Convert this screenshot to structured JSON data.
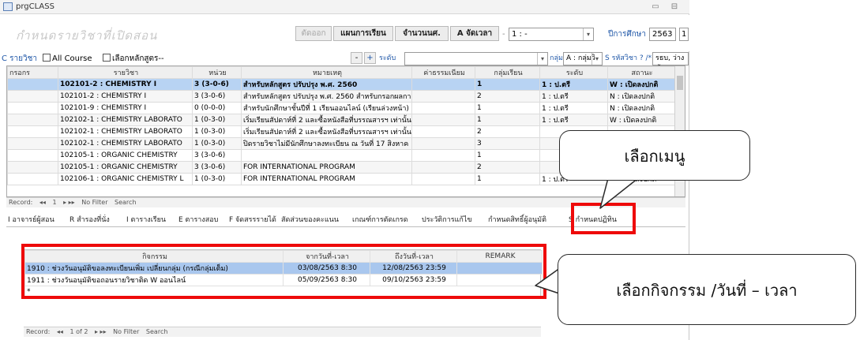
{
  "window": {
    "title": "prgCLASS"
  },
  "header": {
    "logo_text": "กำหนดรายวิชาที่เปิดสอน",
    "delete_label": "ตัดออก",
    "plan_label": "แผนการเรียน",
    "count_label": "จำนวนนศ.",
    "schedule_label": "A จัดเวลา",
    "semester_value": "1 : -",
    "year_label": "ปีการศึกษา",
    "year_value": "2563",
    "year_suffix": "1"
  },
  "filter": {
    "course_label": "C รายวิชา",
    "all_course_label": "All Course",
    "select_curriculum_label": "เลือกหลักสูตร--",
    "level_label": "ระดับ",
    "group_label": "กลุ่ม",
    "group_value": "A : กลุ่มวิ",
    "code_label": "S รหัสวิชา ? /*",
    "code_value": "รธบ, ว่างทั้งห"
  },
  "grid": {
    "columns": [
      "กรอกร",
      "รายวิชา",
      "หน่วย",
      "หมายเหตุ",
      "ค่าธรรมเนียม",
      "กลุ่มเรียน",
      "ระดับ",
      "สถานะ"
    ],
    "rows": [
      [
        "",
        "102101-2 : CHEMISTRY I",
        "3 (3-0-6)",
        "สำหรับหลักสูตร ปรับปรุง พ.ศ. 2560",
        "",
        "1",
        "1 : ป.ตรี",
        "W : เปิดลงปกติ"
      ],
      [
        "",
        "102101-2 : CHEMISTRY I",
        "3 (3-0-6)",
        "สำหรับหลักสูตร ปรับปรุง พ.ศ. 2560 สำหรับกรอกผลกา",
        "",
        "2",
        "1 : ป.ตรี",
        "N : เปิดลงปกติ"
      ],
      [
        "",
        "102101-9 : CHEMISTRY I",
        "0 (0-0-0)",
        "สำหรับนักศึกษาชั้นปีที่ 1 เรียนออนไลน์ (เรียนล่วงหน้า)",
        "",
        "1",
        "1 : ป.ตรี",
        "N : เปิดลงปกติ"
      ],
      [
        "",
        "102102-1 : CHEMISTRY LABORATO",
        "1 (0-3-0)",
        "เริ่มเรียนสัปดาห์ที่ 2 และซื้อหนังสือที่บรรณสารฯ เท่านั้น",
        "",
        "1",
        "1 : ป.ตรี",
        "W : เปิดลงปกติ"
      ],
      [
        "",
        "102102-1 : CHEMISTRY LABORATO",
        "1 (0-3-0)",
        "เริ่มเรียนสัปดาห์ที่ 2 และซื้อหนังสือที่บรรณสารฯ เท่านั้น",
        "",
        "2",
        "",
        ""
      ],
      [
        "",
        "102102-1 : CHEMISTRY LABORATO",
        "1 (0-3-0)",
        "ปิดรายวิชาไม่มีนักศึกษาลงทะเบียน ณ วันที่ 17 สิงหาค",
        "",
        "3",
        "",
        ""
      ],
      [
        "",
        "102105-1 : ORGANIC CHEMISTRY",
        "3 (3-0-6)",
        "",
        "",
        "1",
        "",
        ""
      ],
      [
        "",
        "102105-1 : ORGANIC CHEMISTRY",
        "3 (3-0-6)",
        "FOR INTERNATIONAL PROGRAM",
        "",
        "2",
        "",
        ""
      ],
      [
        "",
        "102106-1 : ORGANIC CHEMISTRY L",
        "1 (0-3-0)",
        "FOR INTERNATIONAL PROGRAM",
        "",
        "1",
        "1 : ป.ตรี",
        "W : เปิดลงปกติ"
      ]
    ],
    "record_label": "Record:",
    "record_pos": "1",
    "no_filter": "No Filter",
    "search": "Search"
  },
  "tabs": [
    "I อาจารย์ผู้สอน",
    "R สำรองที่นั่ง",
    "I ตารางเรียน",
    "E ตารางสอบ",
    "F จัดสรรรายได้",
    "สัดส่วนของคะแนน",
    "เกณฑ์การตัดเกรด",
    "ประวัติการแก้ไข",
    "กำหนดสิทธิ์ผู้อนุมัติ",
    "S กำหนดปฏิทิน"
  ],
  "subform": {
    "columns": [
      "กิจกรรม",
      "จากวันที่-เวลา",
      "ถึงวันที่-เวลา",
      "REMARK"
    ],
    "rows": [
      [
        "1910 : ช่วงวันอนุมัติขอลงทะเบียนเพิ่ม เปลี่ยนกลุ่ม (กรณีกลุ่มเต็ม)",
        "03/08/2563 8:30",
        "12/08/2563 23:59",
        ""
      ],
      [
        "1911 : ช่วงวันอนุมัติขอถอนรายวิชาติด W ออนไลน์",
        "05/09/2563 8:30",
        "09/10/2563 23:59",
        ""
      ]
    ],
    "record_label": "Record:",
    "record_pos": "1 of 2",
    "no_filter": "No Filter",
    "search": "Search"
  },
  "callouts": {
    "menu": "เลือกเมนู",
    "activity": "เลือกกิจกรรม /วันที่ – เวลา"
  },
  "colors": {
    "highlight": "#ee0a0a",
    "selection": "#b8d3f3"
  }
}
